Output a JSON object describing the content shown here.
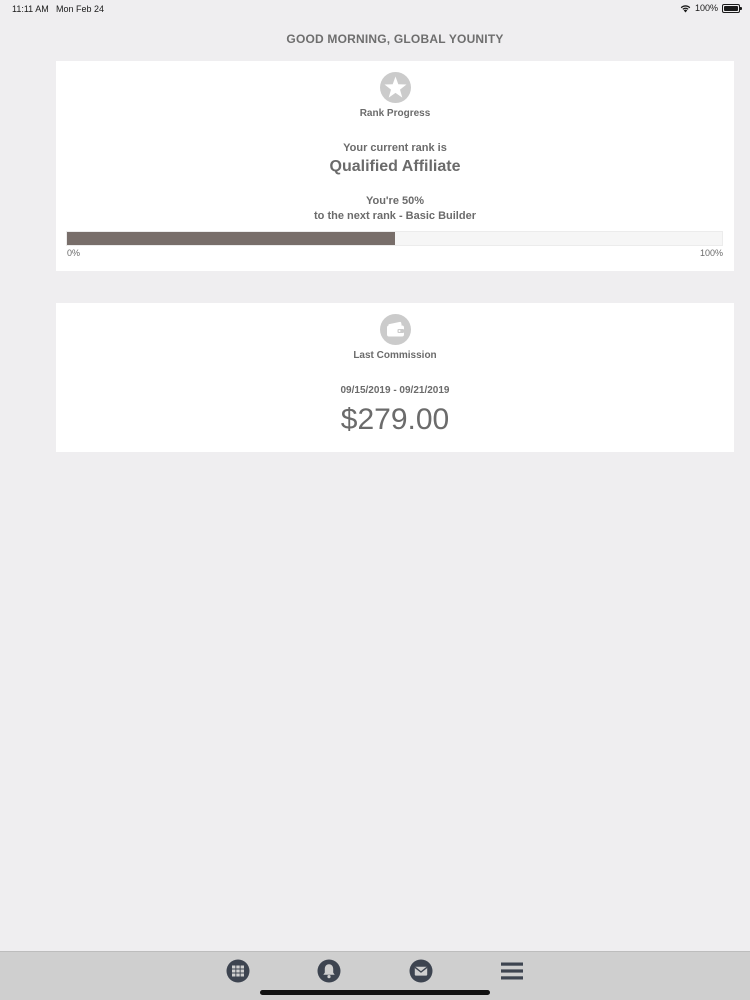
{
  "status_bar": {
    "time": "11:11 AM",
    "date": "Mon Feb 24",
    "battery": "100%",
    "wifi_icon": "wifi-icon",
    "battery_icon": "battery-icon"
  },
  "greeting": "GOOD MORNING, GLOBAL YOUNITY",
  "rank_card": {
    "icon": "star-icon",
    "title": "Rank Progress",
    "current_rank_label": "Your current rank is",
    "current_rank": "Qualified Affiliate",
    "progress_line1": "You're 50%",
    "progress_line2": "to the next rank - Basic Builder",
    "progress_value": 0.5,
    "progress_min_label": "0%",
    "progress_max_label": "100%"
  },
  "commission_card": {
    "icon": "wallet-icon",
    "title": "Last Commission",
    "date_range": "09/15/2019 - 09/21/2019",
    "amount": "$279.00"
  },
  "tab_bar": {
    "items": [
      {
        "icon": "grid-icon"
      },
      {
        "icon": "bell-icon"
      },
      {
        "icon": "mail-icon"
      },
      {
        "icon": "menu-icon"
      }
    ]
  },
  "colors": {
    "background": "#efeef0",
    "card": "#ffffff",
    "text": "#6b6b6b",
    "progress_fill": "#786e6a",
    "tab_bar": "#cfcfcf",
    "tab_icon": "#3d4450"
  }
}
